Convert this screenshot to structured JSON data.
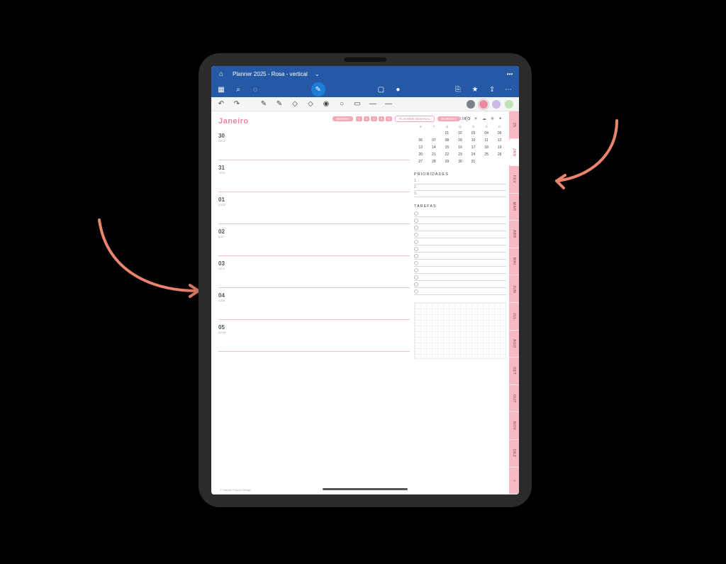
{
  "app": {
    "doc_title": "Planner 2025 - Rosa - vertical",
    "dropdown_caret": "⌄"
  },
  "toolbar": {
    "icons": {
      "home": "⌂",
      "apps": "▦",
      "search": "⌕",
      "lasso": "◌",
      "pen": "✎",
      "image": "▢",
      "mic": "●",
      "addpage": "⎘",
      "bookmark": "★",
      "share": "⇪",
      "more": "⋯"
    }
  },
  "toolbar2": {
    "undo": "↶",
    "redo": "↷",
    "pencil": "✎",
    "pen2": "✎",
    "eraser": "◇",
    "eraser2": "◇",
    "highlighter": "◉",
    "shape": "○",
    "text": "▭",
    "ruler": "—",
    "dash": "—",
    "swatches": [
      "#7a7f8a",
      "#f08aa0",
      "#c9b8ea",
      "#bfe3b4"
    ]
  },
  "pillrow": {
    "btn_semana": "SEMANA",
    "nums": [
      "1",
      "2",
      "3",
      "4",
      "5"
    ],
    "btn_planner": "PLANNER SEMANAL",
    "btn_domingo": "DOMINGO",
    "tracker_icons": [
      "◯",
      "☀",
      "☁",
      "❄",
      "✦"
    ]
  },
  "planner": {
    "month_title": "Janeiro",
    "days": [
      {
        "num": "30",
        "dow": "SEG"
      },
      {
        "num": "31",
        "dow": "TER"
      },
      {
        "num": "01",
        "dow": "QUA"
      },
      {
        "num": "02",
        "dow": "QUI"
      },
      {
        "num": "03",
        "dow": "SEX"
      },
      {
        "num": "04",
        "dow": "SÁB"
      },
      {
        "num": "05",
        "dow": "DOM"
      }
    ],
    "footer": "© Yasmin Furuya Design"
  },
  "minical": {
    "title": "JANEIRO",
    "dows": [
      "S",
      "T",
      "Q",
      "Q",
      "S",
      "S",
      "D"
    ],
    "rows": [
      [
        "",
        "",
        "01",
        "02",
        "03",
        "04",
        "05"
      ],
      [
        "06",
        "07",
        "08",
        "09",
        "10",
        "11",
        "12"
      ],
      [
        "13",
        "14",
        "15",
        "16",
        "17",
        "18",
        "19"
      ],
      [
        "20",
        "21",
        "22",
        "23",
        "24",
        "25",
        "26"
      ],
      [
        "27",
        "28",
        "29",
        "30",
        "31",
        "",
        ""
      ]
    ]
  },
  "sections": {
    "prioridades": "PRIORIDADES",
    "priori_lines": [
      "1.",
      "2.",
      "3."
    ],
    "tarefas": "TAREFAS",
    "task_count": 12
  },
  "side_tabs": [
    "25",
    "JAN",
    "FEV",
    "MAR",
    "ABR",
    "MAI",
    "JUN",
    "JUL",
    "AGO",
    "SET",
    "OUT",
    "NOV",
    "DEZ",
    "+"
  ],
  "active_tab_index": 1,
  "colors": {
    "accent": "#e58b9a",
    "toolbar_blue": "#2559a6"
  }
}
